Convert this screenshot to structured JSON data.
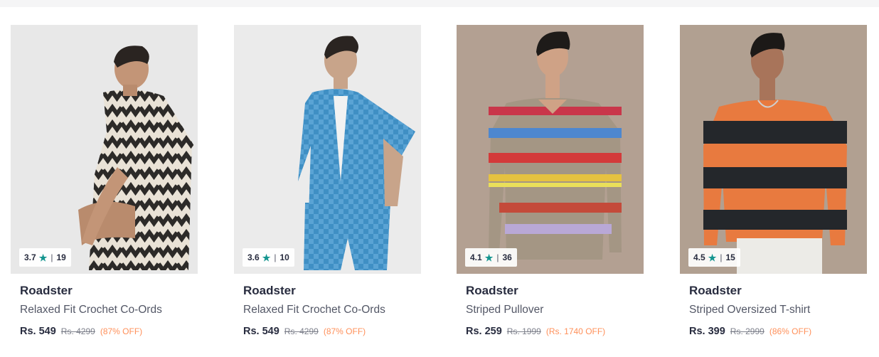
{
  "products": [
    {
      "rating": "3.7",
      "rating_count": "19",
      "brand": "Roadster",
      "name": "Relaxed Fit Crochet Co-Ords",
      "price": "Rs. 549",
      "mrp": "Rs. 4299",
      "discount": "(87% OFF)",
      "bg": "#e8e8e8",
      "garment": "#2c2a28",
      "garment2": "#e9e2d6"
    },
    {
      "rating": "3.6",
      "rating_count": "10",
      "brand": "Roadster",
      "name": "Relaxed Fit Crochet Co-Ords",
      "price": "Rs. 549",
      "mrp": "Rs. 4299",
      "discount": "(87% OFF)",
      "bg": "#ebebeb",
      "garment": "#3f8fc4",
      "garment2": "#5aa3d4"
    },
    {
      "rating": "4.1",
      "rating_count": "36",
      "brand": "Roadster",
      "name": "Striped Pullover",
      "price": "Rs. 259",
      "mrp": "Rs. 1999",
      "discount": "(Rs. 1740 OFF)",
      "bg": "#b3a092",
      "garment": "#a49684",
      "garment2": "#c9364a"
    },
    {
      "rating": "4.5",
      "rating_count": "15",
      "brand": "Roadster",
      "name": "Striped Oversized T-shirt",
      "price": "Rs. 399",
      "mrp": "Rs. 2999",
      "discount": "(86% OFF)",
      "bg": "#b1a091",
      "garment": "#e87a3f",
      "garment2": "#24272b"
    }
  ]
}
